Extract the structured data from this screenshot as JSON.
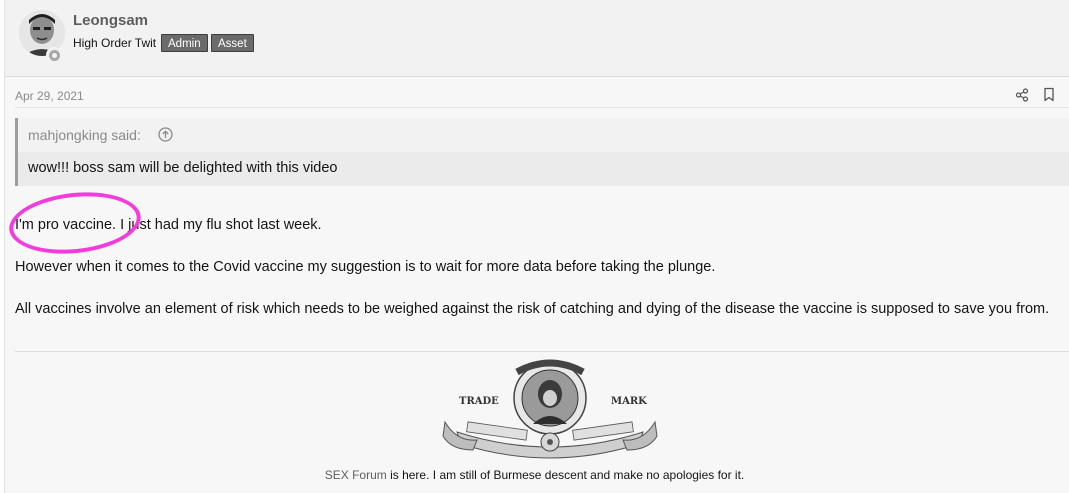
{
  "user": {
    "name": "Leongsam",
    "title": "High Order Twit",
    "badges": [
      "Admin",
      "Asset"
    ]
  },
  "post": {
    "date": "Apr 29, 2021"
  },
  "quote": {
    "author": "mahjongking said:",
    "text": "wow!!! boss sam will be delighted with this video"
  },
  "message": {
    "line1": "I'm pro vaccine. I just had my flu shot last week.",
    "line2": "However when it comes to the Covid vaccine my suggestion is to wait for more data before taking the plunge.",
    "line3": "All vaccines involve an element of risk which needs to be weighed against the risk of catching and dying of the disease the vaccine is supposed to save you from."
  },
  "signature": {
    "logo_left": "TRADE",
    "logo_right": "MARK",
    "link": "SEX Forum",
    "text": " is here. I am still of Burmese descent and make no apologies for it."
  },
  "colors": {
    "annotation": "#f43bdc",
    "badge_bg": "#6b6b6b"
  },
  "icons": [
    "share-icon",
    "bookmark-icon",
    "quote-jump-icon",
    "user-status-icon"
  ]
}
